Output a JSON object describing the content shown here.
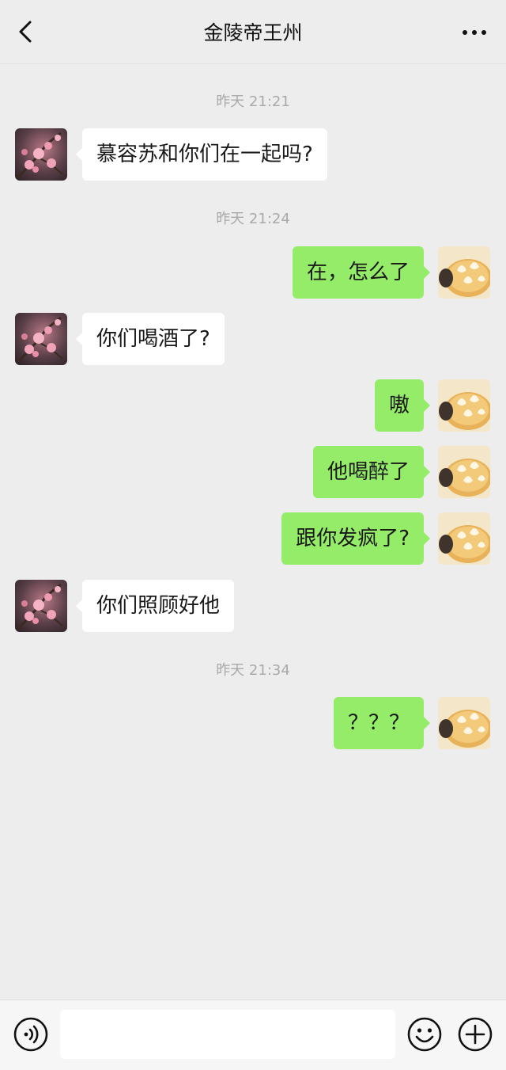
{
  "header": {
    "title": "金陵帝王州",
    "back_icon": "chevron-left-icon",
    "more_icon": "more-dots-icon"
  },
  "messages": [
    {
      "type": "timestamp",
      "text": "昨天 21:21"
    },
    {
      "type": "message",
      "side": "left",
      "text": "慕容苏和你们在一起吗?"
    },
    {
      "type": "timestamp",
      "text": "昨天 21:24"
    },
    {
      "type": "message",
      "side": "right",
      "text": "在，怎么了"
    },
    {
      "type": "message",
      "side": "left",
      "text": "你们喝酒了?"
    },
    {
      "type": "message",
      "side": "right",
      "text": "嗷"
    },
    {
      "type": "message",
      "side": "right",
      "text": "他喝醉了"
    },
    {
      "type": "message",
      "side": "right",
      "text": "跟你发疯了?"
    },
    {
      "type": "message",
      "side": "left",
      "text": "你们照顾好他"
    },
    {
      "type": "timestamp",
      "text": "昨天 21:34"
    },
    {
      "type": "message",
      "side": "right",
      "text": "？？？"
    }
  ],
  "input": {
    "value": "",
    "placeholder": "",
    "voice_icon": "voice-icon",
    "emoji_icon": "emoji-icon",
    "plus_icon": "plus-icon"
  },
  "colors": {
    "background": "#ededed",
    "my_bubble": "#95ec69",
    "their_bubble": "#ffffff",
    "timestamp_text": "#a9a9a9"
  }
}
